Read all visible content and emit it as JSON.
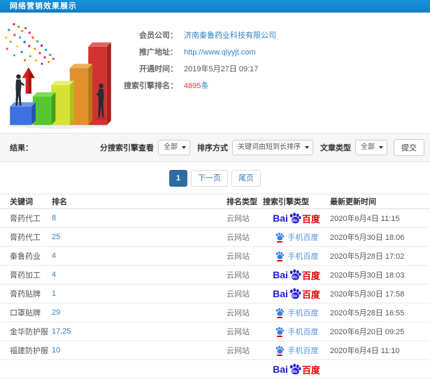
{
  "window": {
    "title": "网络营销效果展示"
  },
  "info": {
    "member_label": "会员公司：",
    "member_value": "济南秦鲁药业科技有限公司",
    "url_label": "推广地址：",
    "url_value": "http://www.qlyyjt.com",
    "open_label": "开通时间：",
    "open_value": "2019年5月27日 09:17",
    "rank_label": "搜索引擎排名：",
    "rank_count": "4895",
    "rank_unit": "条"
  },
  "filters": {
    "result_label": "结果：",
    "engine_label": "分搜索引擎查看",
    "engine_value": "全部",
    "sort_label": "排序方式",
    "sort_value": "关键词由短到长排序",
    "article_label": "文章类型",
    "article_value": "全部",
    "submit_label": "提交"
  },
  "pagination": {
    "current": "1",
    "next_label": "下一页",
    "last_label": "尾页"
  },
  "table": {
    "headers": {
      "keyword": "关键词",
      "rank": "排名",
      "rank_type": "排名类型",
      "engine": "搜索引擎类型",
      "updated": "最新更新时间"
    },
    "engine_labels": {
      "baidu_bai": "Bai",
      "baidu_du": "du",
      "baidu_cn": "百度",
      "baidu_mobile": "手机百度"
    },
    "rows": [
      {
        "keyword": "膏药代工",
        "rank": "8",
        "rank_type": "云网站",
        "engine": "baidu",
        "updated": "2020年6月4日 11:15"
      },
      {
        "keyword": "膏药代工",
        "rank": "25",
        "rank_type": "云网站",
        "engine": "baidu-mobile",
        "updated": "2020年5月30日 18:06"
      },
      {
        "keyword": "秦鲁药业",
        "rank": "4",
        "rank_type": "云网站",
        "engine": "baidu-mobile",
        "updated": "2020年5月28日 17:02"
      },
      {
        "keyword": "膏药加工",
        "rank": "4",
        "rank_type": "云网站",
        "engine": "baidu",
        "updated": "2020年5月30日 18:03"
      },
      {
        "keyword": "膏药贴牌",
        "rank": "1",
        "rank_type": "云网站",
        "engine": "baidu",
        "updated": "2020年5月30日 17:58"
      },
      {
        "keyword": "口罩贴牌",
        "rank": "29",
        "rank_type": "云网站",
        "engine": "baidu-mobile",
        "updated": "2020年5月28日 16:55"
      },
      {
        "keyword": "金华防护服",
        "rank": "17,25",
        "rank_type": "云网站",
        "engine": "baidu-mobile",
        "updated": "2020年6月20日 09:25"
      },
      {
        "keyword": "福建防护服",
        "rank": "10",
        "rank_type": "云网站",
        "engine": "baidu-mobile",
        "updated": "2020年6月4日 11:10"
      },
      {
        "keyword": "",
        "rank": "",
        "rank_type": "",
        "engine": "baidu",
        "updated": "",
        "partial": true
      }
    ]
  },
  "colors": {
    "header_bar": "#1486d0",
    "link_blue": "#3183c4",
    "count_red": "#e4393c",
    "active_page_blue": "#2e6da4",
    "baidu_blue": "#2319dc",
    "baidu_red": "#e10602",
    "mobile_text_blue": "#5a92d8"
  }
}
